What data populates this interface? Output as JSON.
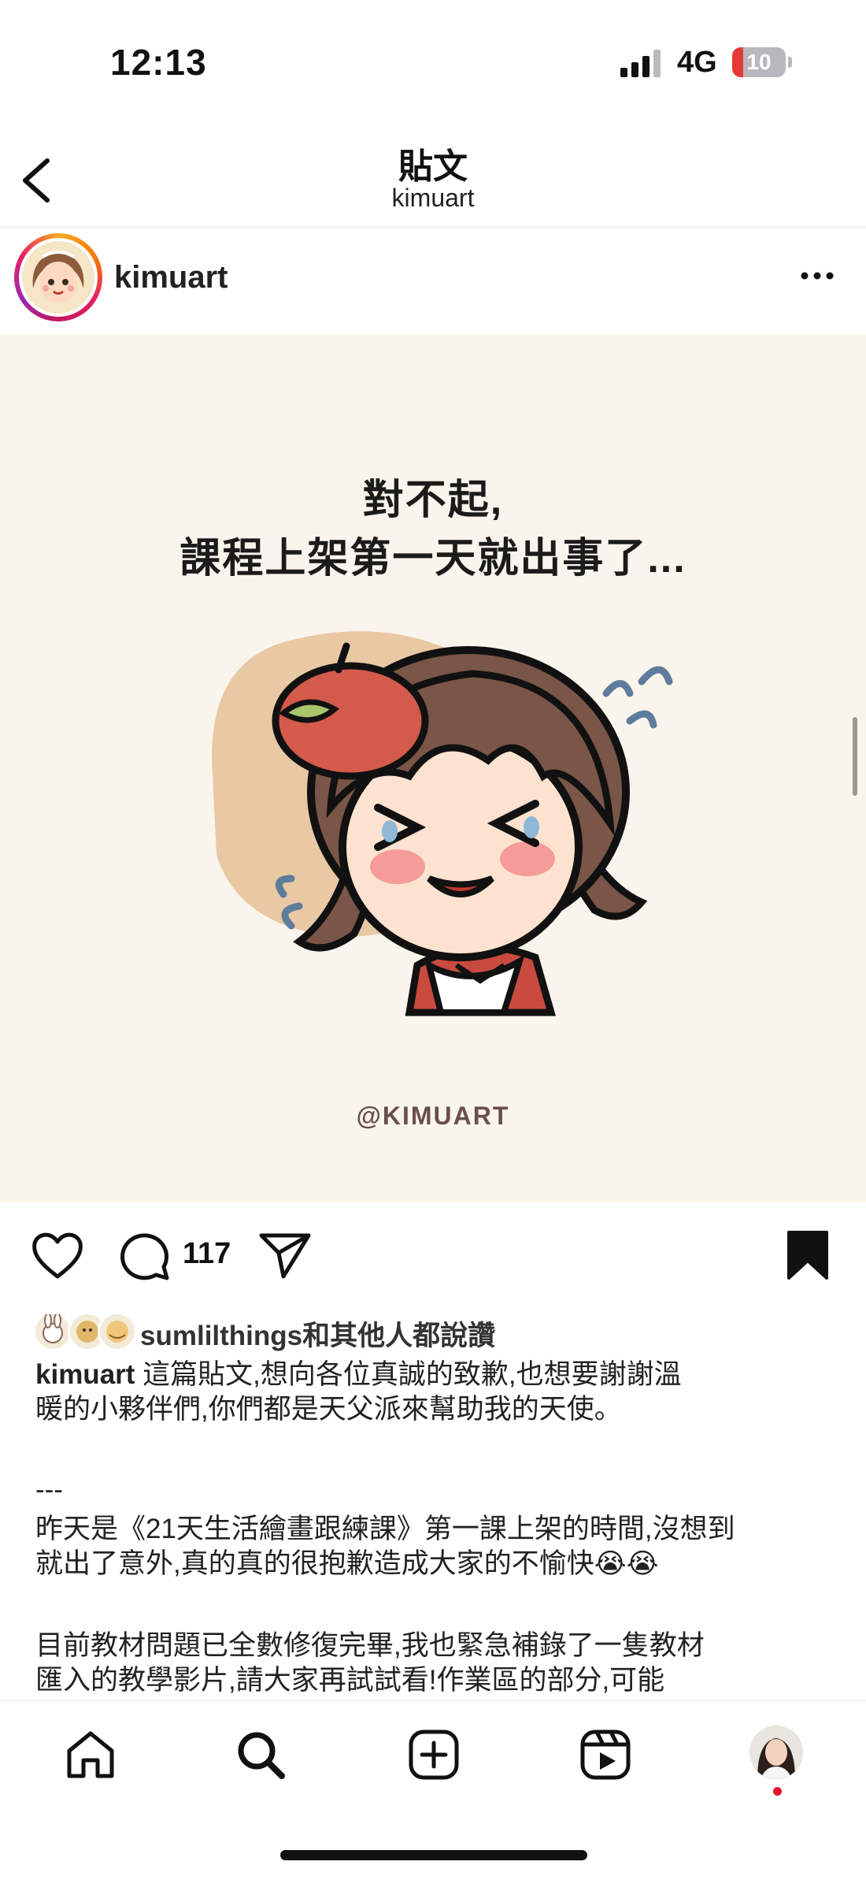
{
  "status_bar": {
    "time": "12:13",
    "network": "4G",
    "battery": "10"
  },
  "header": {
    "title": "貼文",
    "subtitle": "kimuart",
    "back_icon": "chevron-left-icon"
  },
  "post": {
    "author": "kimuart",
    "image": {
      "title_line1": "對不起,",
      "title_line2": "課程上架第一天就出事了...",
      "credit": "@KIMUART"
    },
    "comment_count": "117",
    "likes_text": "sumlilthings和其他人都說讚",
    "caption": {
      "username": "kimuart",
      "line1": "這篇貼文,想向各位真誠的致歉,也想要謝謝溫",
      "line2": "暖的小夥伴們,你們都是天父派來幫助我的天使。",
      "divider": "---",
      "line3": "昨天是《21天生活繪畫跟練課》第一課上架的時間,沒想到",
      "line4": "就出了意外,真的真的很抱歉造成大家的不愉快😭😭",
      "line5": "目前教材問題已全數修復完畢,我也緊急補錄了一隻教材",
      "line6": "匯入的教學影片,請大家再試試看!作業區的部分,可能"
    }
  },
  "colors": {
    "accent_red": "#e8112d",
    "image_bg": "#faf5ec",
    "text": "#111111"
  }
}
